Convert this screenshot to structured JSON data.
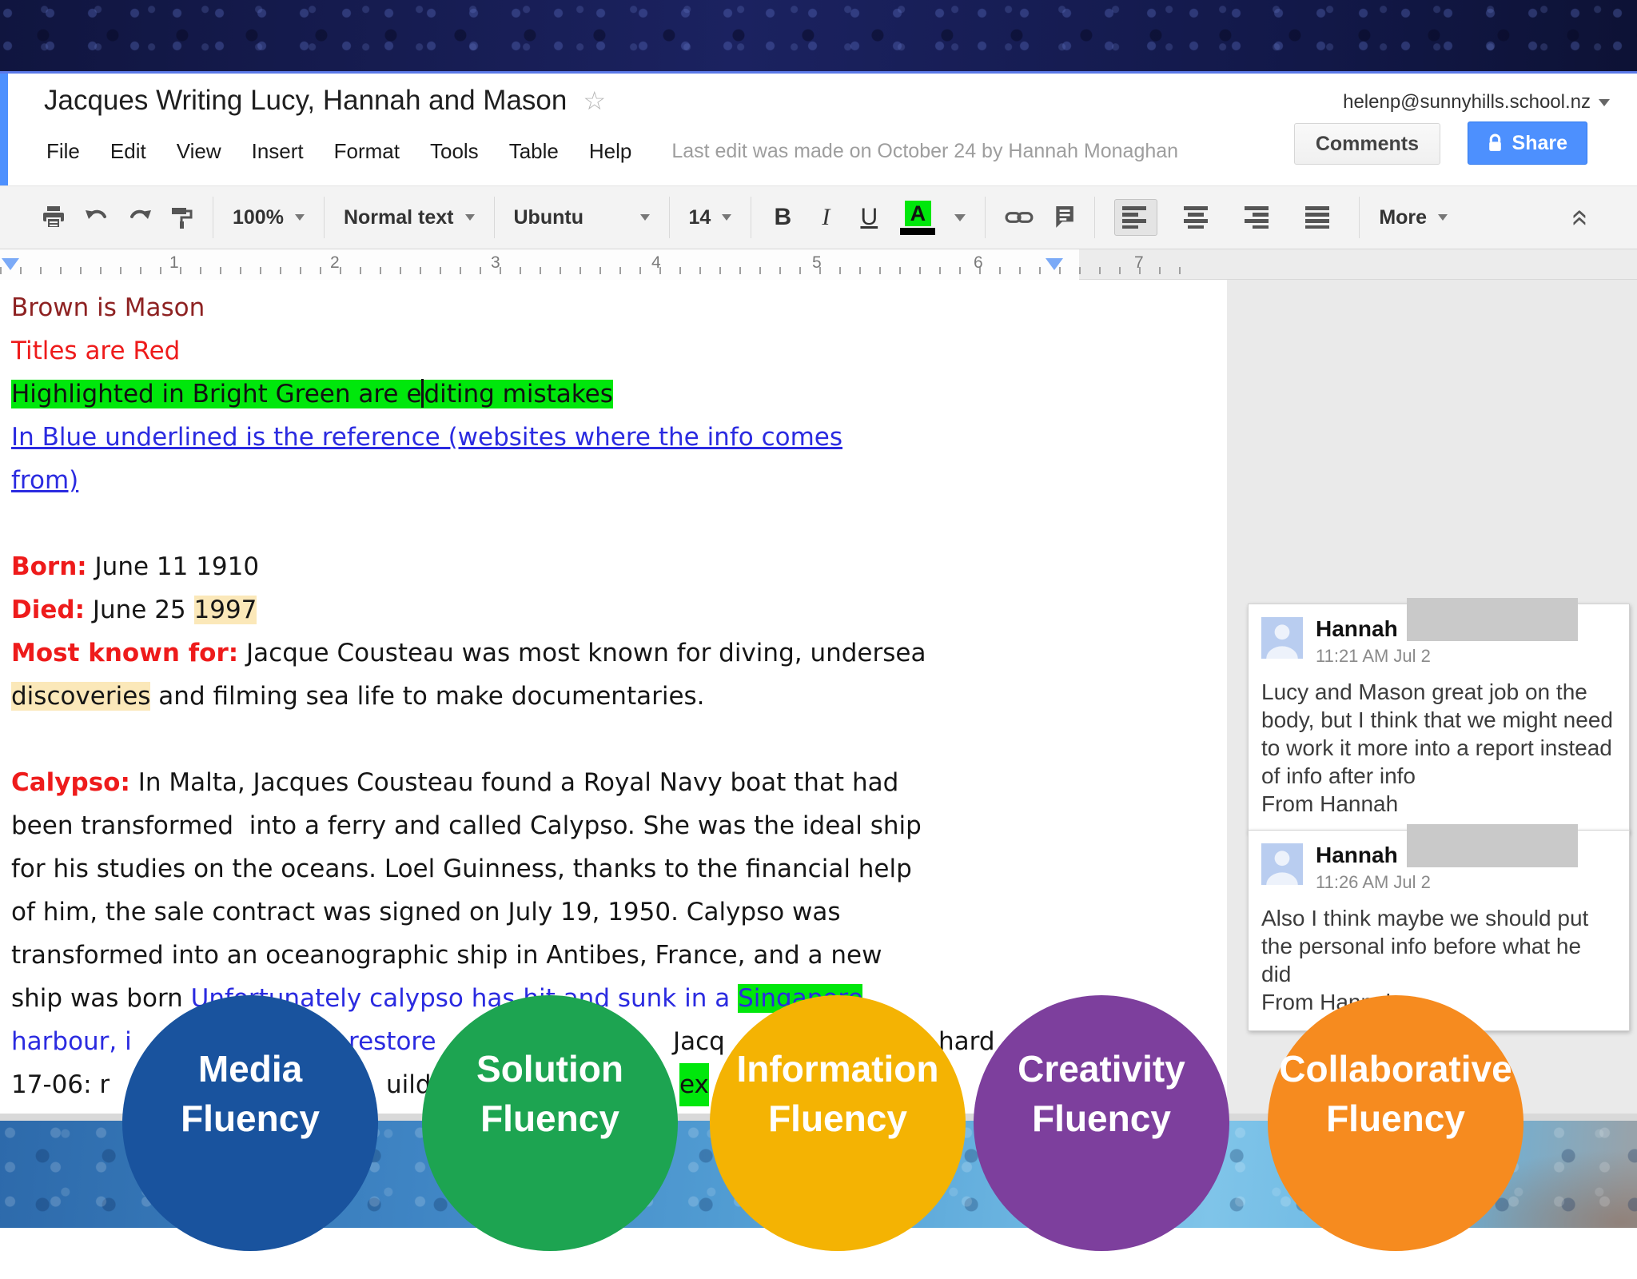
{
  "header": {
    "title": "Jacques Writing Lucy, Hannah and Mason",
    "account_email": "helenp@sunnyhills.school.nz",
    "comments_button": "Comments",
    "share_button": "Share",
    "menus": [
      "File",
      "Edit",
      "View",
      "Insert",
      "Format",
      "Tools",
      "Table",
      "Help"
    ],
    "last_edit": "Last edit was made on October 24 by Hannah Monaghan"
  },
  "toolbar": {
    "zoom": "100%",
    "paragraph_style": "Normal text",
    "font": "Ubuntu",
    "font_size": "14",
    "bold": "B",
    "italic": "I",
    "underline": "U",
    "text_color": "A",
    "more": "More"
  },
  "ruler": {
    "numbers": [
      "1",
      "2",
      "3",
      "4",
      "5",
      "6",
      "7"
    ]
  },
  "document": {
    "l1": "Brown is Mason",
    "l2": "Titles are Red",
    "l3a": "Highlighted in Bright Green are e",
    "l3b": "diting mistakes",
    "l4": "In Blue underlined is the reference (websites where the info comes",
    "l5": "from)",
    "born_label": "Born:",
    "born_rest": " June 11 1910",
    "died_label": "Died:",
    "died_mid": " June 25 ",
    "died_year": "1997",
    "mkf_label": "Most known for:",
    "mkf_rest": " Jacque Cousteau was most known for diving, undersea",
    "mkf2_hl": "discoveries",
    "mkf2_rest": " and filming sea life to make documentaries.",
    "cal_label": "Calypso:",
    "cal_l1": " In Malta, Jacques Cousteau found a Royal Navy boat that had",
    "cal_l2": "been transformed  into a ferry and called Calypso. She was the ideal ship",
    "cal_l3": "for his studies on the oceans. Loel Guinness, thanks to the financial help",
    "cal_l4": "of him, the sale contract was signed on July 19, 1950. Calypso was",
    "cal_l5": "transformed into an oceanographic ship in Antibes, France, and a new",
    "cal_l6a": "ship was born ",
    "cal_l6b": "Unfortunately calypso has hit and sunk in a ",
    "cal_l6c": "Singapore",
    "frag_harbour": "harbour, i",
    "frag_restore": "restore",
    "frag_jacq": "Jacq",
    "frag_hard": "hard",
    "frag_1706": "17-06: r",
    "frag_uild": "uild",
    "frag_ex": "ex"
  },
  "comments": [
    {
      "author": "Hannah",
      "time": "11:21 AM Jul 2",
      "body": "Lucy and Mason great job on the body, but I think that we might need to work it more into a report instead of info after info\nFrom Hannah"
    },
    {
      "author": "Hannah",
      "time": "11:26 AM Jul 2",
      "body": "Also I think maybe we should put the personal info before what he did\nFrom Hannah"
    }
  ],
  "bubbles": [
    {
      "line1": "Media",
      "line2": "Fluency",
      "color": "#19539e"
    },
    {
      "line1": "Solution",
      "line2": "Fluency",
      "color": "#1da451"
    },
    {
      "line1": "Information",
      "line2": "Fluency",
      "color": "#f4b303"
    },
    {
      "line1": "Creativity",
      "line2": "Fluency",
      "color": "#7d3f9d"
    },
    {
      "line1": "Collaborative",
      "line2": "Fluency",
      "color": "#f68b1f"
    }
  ],
  "colors": {
    "accent_blue": "#4d90fe",
    "highlight_green": "#00e70c",
    "highlight_cream": "#fbe8b9",
    "link_blue": "#2b2be0",
    "title_red": "#ee1b1b",
    "brown_red": "#8e2222",
    "sidebar_gray": "#eaeaea"
  }
}
